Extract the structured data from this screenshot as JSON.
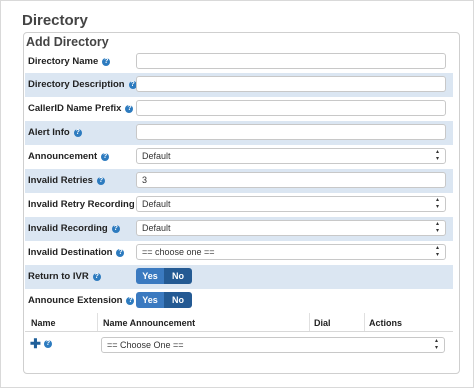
{
  "page": {
    "title": "Directory"
  },
  "panel": {
    "title": "Add Directory"
  },
  "fields": {
    "directory_name": {
      "label": "Directory Name",
      "value": ""
    },
    "directory_description": {
      "label": "Directory Description",
      "value": ""
    },
    "callerid_prefix": {
      "label": "CallerID Name Prefix",
      "value": ""
    },
    "alert_info": {
      "label": "Alert Info",
      "value": ""
    },
    "announcement": {
      "label": "Announcement",
      "value": "Default"
    },
    "invalid_retries": {
      "label": "Invalid Retries",
      "value": "3"
    },
    "invalid_retry_recording": {
      "label": "Invalid Retry Recording",
      "value": "Default"
    },
    "invalid_recording": {
      "label": "Invalid Recording",
      "value": "Default"
    },
    "invalid_destination": {
      "label": "Invalid Destination",
      "value": "== choose one =="
    },
    "return_to_ivr": {
      "label": "Return to IVR",
      "yes": "Yes",
      "no": "No",
      "selected": "No"
    },
    "announce_extension": {
      "label": "Announce Extension",
      "yes": "Yes",
      "no": "No",
      "selected": "No"
    }
  },
  "help_icon": "question-mark-icon",
  "entries_table": {
    "columns": [
      "Name",
      "Name Announcement",
      "Dial",
      "Actions"
    ],
    "add_icon": "plus-icon",
    "row_select": "== Choose One =="
  },
  "colors": {
    "accent": "#3b7ac0",
    "highlight_row": "#dbe6f2"
  }
}
